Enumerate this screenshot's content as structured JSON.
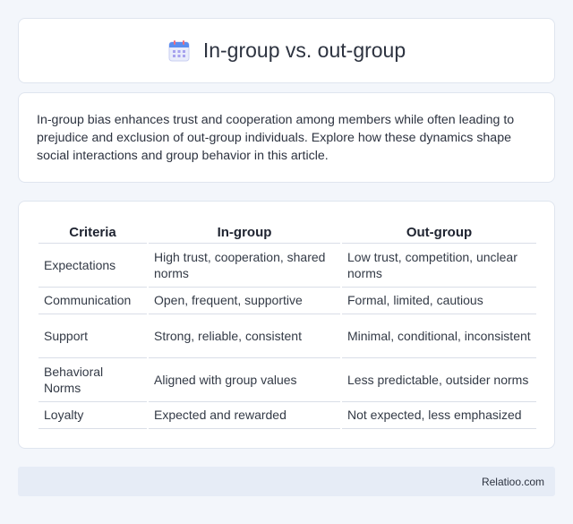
{
  "header": {
    "title": "In-group vs. out-group",
    "icon": "calendar-icon"
  },
  "intro": {
    "text": "In-group bias enhances trust and cooperation among members while often leading to prejudice and exclusion of out-group individuals. Explore how these dynamics shape social interactions and group behavior in this article."
  },
  "table": {
    "headers": [
      "Criteria",
      "In-group",
      "Out-group"
    ],
    "rows": [
      [
        "Expectations",
        "High trust, cooperation, shared norms",
        "Low trust, competition, unclear norms"
      ],
      [
        "Communication",
        "Open, frequent, supportive",
        "Formal, limited, cautious"
      ],
      [
        "Support",
        "Strong, reliable, consistent",
        "Minimal, conditional, inconsistent"
      ],
      [
        "Behavioral Norms",
        "Aligned with group values",
        "Less predictable, outsider norms"
      ],
      [
        "Loyalty",
        "Expected and rewarded",
        "Not expected, less emphasized"
      ]
    ]
  },
  "footer": {
    "brand": "Relatioo.com"
  }
}
